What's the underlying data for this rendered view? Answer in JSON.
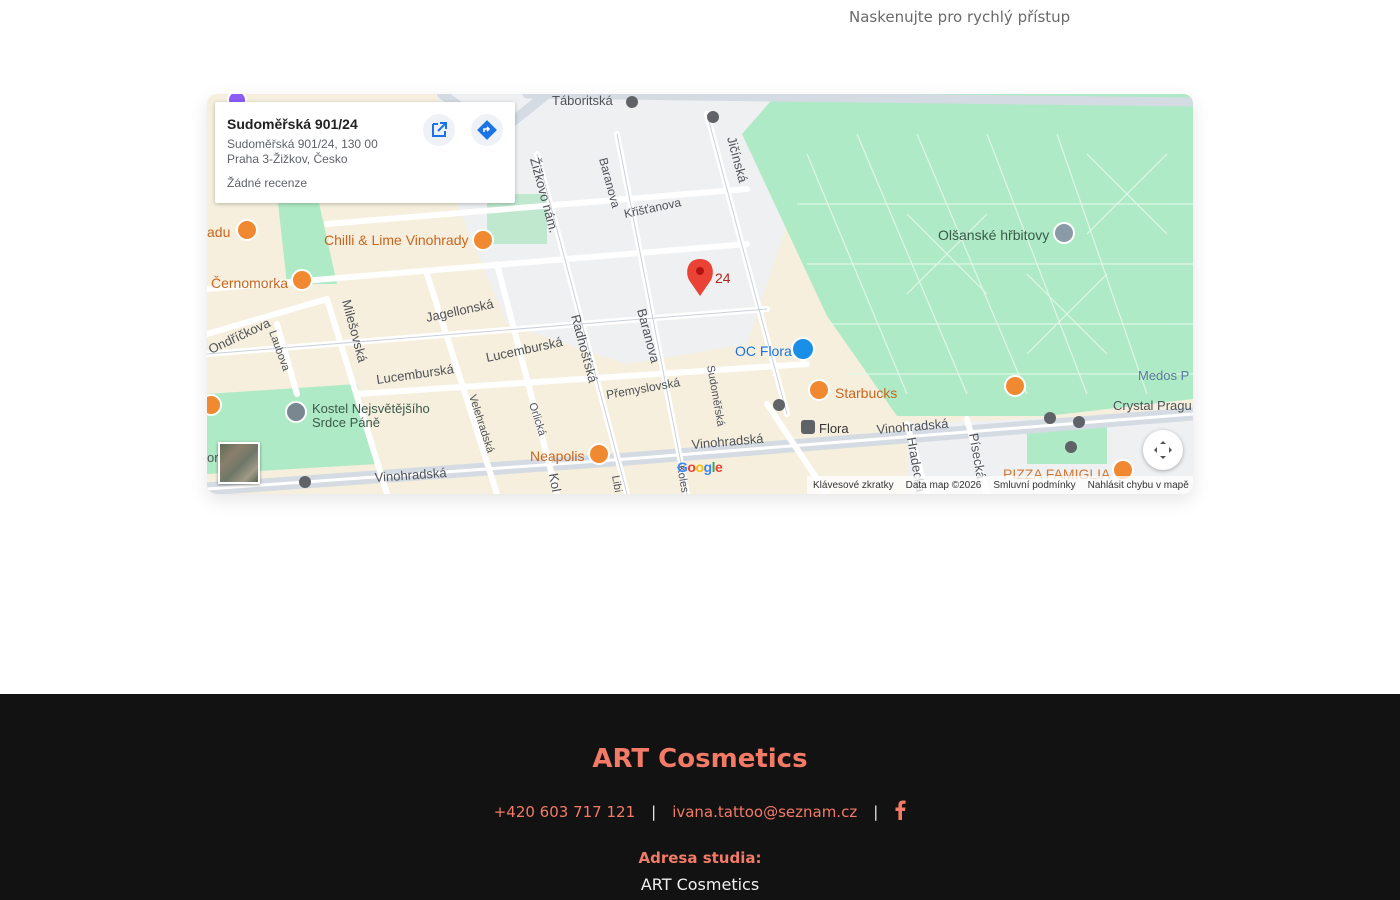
{
  "scan_hint": "Naskenujte pro rychlý přístup",
  "map": {
    "place_title": "Sudoměřská 901/24",
    "address_line1": "Sudoměřská 901/24, 130 00",
    "address_line2": "Praha 3-Žižkov, Česko",
    "reviews": "Žádné recenze",
    "pin_label": "24",
    "labels": {
      "taboritska": "Táboritská",
      "jicinska": "Jičínská",
      "zizkovo": "Žižkovo nám.",
      "baranova_top": "Baranova",
      "kristanova": "Křišťanova",
      "olsanske": "Olšanské hřbitovy",
      "chilli": "Chilli & Lime Vinohrady",
      "adu": "adu",
      "cernomorka": "Černomorka",
      "jagellonska": "Jagellonská",
      "milesovska": "Milešovská",
      "ondrickova": "Ondříčkova",
      "laubova": "Laubova",
      "lucemburska1": "Lucemburská",
      "lucemburska2": "Lucemburská",
      "radhostska": "Radhošťská",
      "baranova_mid": "Baranova",
      "ocflora": "OC Flora",
      "medos": "Medos P",
      "starbucks": "Starbucks",
      "crystal": "Crystal Pragu",
      "premyslovska": "Přemyslovská",
      "sudomerska": "Sudoměřská",
      "kostel": "Kostel Nejsvětějšího",
      "srdce": "Srdce Páně",
      "velehradska": "Velehradská",
      "oricka": "Orlická",
      "flora": "Flora",
      "vinohradska1": "Vinohradská",
      "vinohradska2": "Vinohradská",
      "vinohradska3": "Vinohradská",
      "neapolis": "Neapolis",
      "hradecka": "Hradecká",
      "pisecka": "Písecká",
      "pizza": "PIZZA FAMIGLIA",
      "kol": "Kol",
      "libi": "Libi",
      "koles": "Koles",
      "or": "or",
      "li": "li",
      "ol": "ol"
    },
    "footer": {
      "shortcuts": "Klávesové zkratky",
      "data": "Data map ©2026",
      "terms": "Smluvní podmínky",
      "report": "Nahlásit chybu v mapě"
    },
    "google": [
      "G",
      "o",
      "o",
      "g",
      "l",
      "e"
    ]
  },
  "footer": {
    "brand": "ART Cosmetics",
    "phone": "+420 603 717 121",
    "separator": "|",
    "email": "ivana.tattoo@seznam.cz",
    "facebook_icon": "facebook-icon",
    "address_label": "Adresa studia:",
    "address_name": "ART Cosmetics",
    "accent_color": "#f37a66"
  }
}
